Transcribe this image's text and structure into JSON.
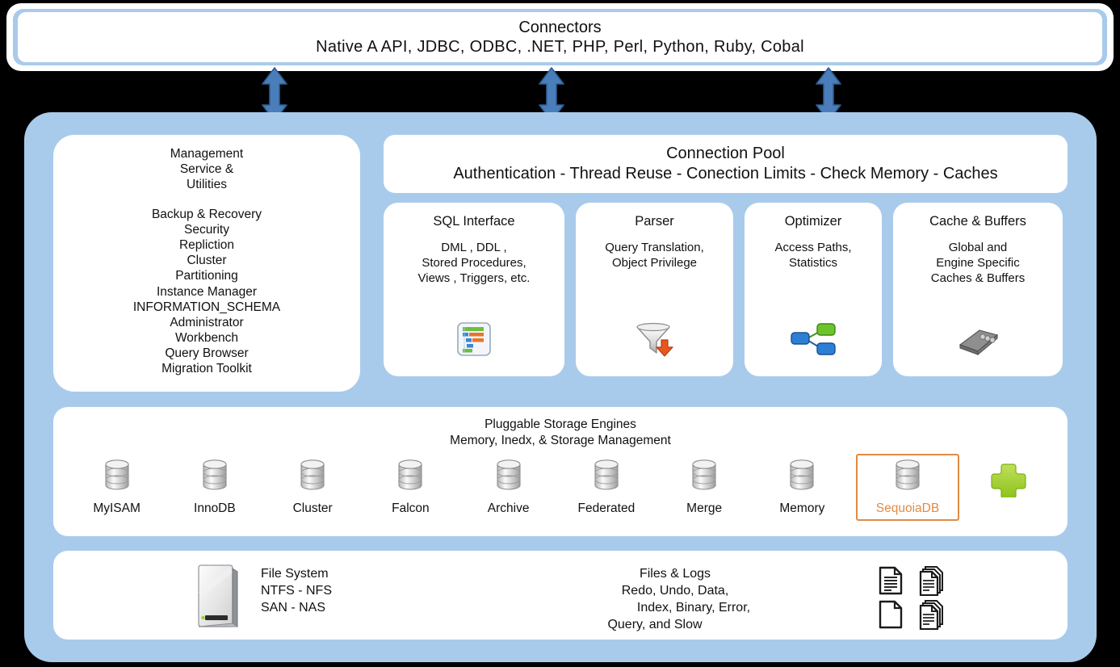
{
  "connectors": {
    "title": "Connectors",
    "list": "Native A API,  JDBC,  ODBC,   .NET,  PHP,  Perl,  Python,  Ruby,  Cobal"
  },
  "arrows": {
    "icon": "double-headed-arrow-icon",
    "color": "#4a7ebb",
    "count": 3
  },
  "management": {
    "header_lines": [
      "Management",
      "Service &",
      "Utilities"
    ],
    "items": [
      "Backup & Recovery",
      "Security",
      "Repliction",
      "Cluster",
      "Partitioning",
      "Instance Manager",
      "INFORMATION_SCHEMA",
      "Administrator",
      "Workbench",
      "Query Browser",
      "Migration Toolkit"
    ]
  },
  "connection_pool": {
    "title": "Connection Pool",
    "subtitle": "Authentication - Thread Reuse - Conection Limits - Check Memory - Caches"
  },
  "modules": [
    {
      "title": "SQL Interface",
      "desc_lines": [
        "DML , DDL ,",
        "Stored Procedures,",
        "Views , Triggers, etc."
      ],
      "icon": "gantt-chart-icon"
    },
    {
      "title": "Parser",
      "desc_lines": [
        "Query Translation,",
        "Object Privilege"
      ],
      "icon": "funnel-filter-icon"
    },
    {
      "title": "Optimizer",
      "desc_lines": [
        "Access Paths,",
        "Statistics"
      ],
      "icon": "node-graph-icon"
    },
    {
      "title": "Cache & Buffers",
      "desc_lines": [
        "Global and",
        "Engine Specific",
        "Caches & Buffers"
      ],
      "icon": "memory-chip-icon"
    }
  ],
  "storage": {
    "heading_line1": "Pluggable Storage Engines",
    "heading_line2": "Memory, Inedx, &  Storage Management",
    "highlight_color": "#e08b45",
    "engines": [
      {
        "label": "MyISAM",
        "icon": "database-cylinder-icon",
        "highlighted": false
      },
      {
        "label": "InnoDB",
        "icon": "database-cylinder-icon",
        "highlighted": false
      },
      {
        "label": "Cluster",
        "icon": "database-cylinder-icon",
        "highlighted": false
      },
      {
        "label": "Falcon",
        "icon": "database-cylinder-icon",
        "highlighted": false
      },
      {
        "label": "Archive",
        "icon": "database-cylinder-icon",
        "highlighted": false
      },
      {
        "label": "Federated",
        "icon": "database-cylinder-icon",
        "highlighted": false
      },
      {
        "label": "Merge",
        "icon": "database-cylinder-icon",
        "highlighted": false
      },
      {
        "label": "Memory",
        "icon": "database-cylinder-icon",
        "highlighted": false
      },
      {
        "label": "SequoiaDB",
        "icon": "database-cylinder-icon",
        "highlighted": true
      }
    ],
    "add_icon": "green-plus-icon",
    "add_icon_color": "#9bd034"
  },
  "filesystem": {
    "drive_icon": "hard-drive-icon",
    "lines": [
      "File System",
      "NTFS - NFS",
      "SAN - NAS"
    ],
    "logs_lines": [
      "Files &  Logs",
      "Redo, Undo, Data,",
      "Index, Binary, Error,",
      "Query, and Slow"
    ],
    "log_icons": [
      "document-icon",
      "documents-stack-icon",
      "blank-document-icon",
      "documents-stack-icon"
    ]
  },
  "colors": {
    "shell_blue": "#a9cbeb",
    "panel_white": "#ffffff",
    "background": "#000000",
    "arrow_blue": "#4a7ebb",
    "accent_orange": "#e08b45",
    "accent_green": "#9bd034"
  }
}
